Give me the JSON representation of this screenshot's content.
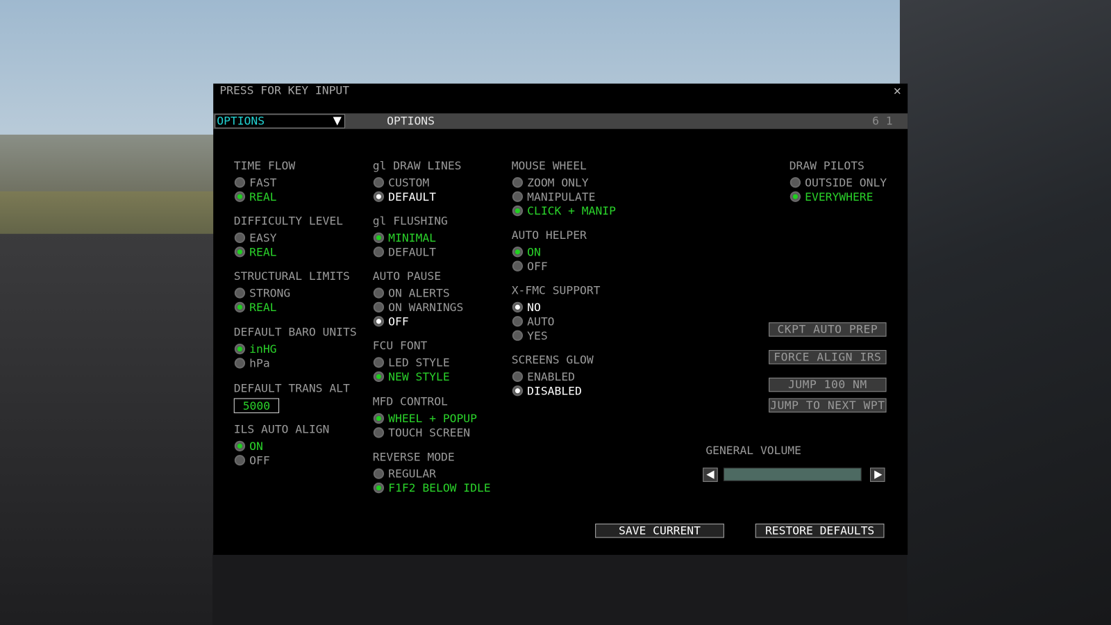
{
  "window": {
    "title": "PRESS FOR KEY INPUT",
    "close_icon": "close-icon"
  },
  "header_bar": {
    "dropdown_value": "OPTIONS",
    "title": "OPTIONS",
    "page_indicator": "6 1"
  },
  "groups": [
    {
      "title": "TIME FLOW",
      "options": [
        {
          "label": "FAST",
          "state": "off"
        },
        {
          "label": "REAL",
          "state": "green"
        }
      ]
    },
    {
      "title": "DIFFICULTY LEVEL",
      "options": [
        {
          "label": "EASY",
          "state": "off"
        },
        {
          "label": "REAL",
          "state": "green"
        }
      ]
    },
    {
      "title": "STRUCTURAL LIMITS",
      "options": [
        {
          "label": "STRONG",
          "state": "off"
        },
        {
          "label": "REAL",
          "state": "green"
        }
      ]
    },
    {
      "title": "DEFAULT BARO UNITS",
      "options": [
        {
          "label": "inHG",
          "state": "green"
        },
        {
          "label": "hPa",
          "state": "off"
        }
      ]
    },
    {
      "title": "ILS AUTO ALIGN",
      "options": [
        {
          "label": "ON",
          "state": "green"
        },
        {
          "label": "OFF",
          "state": "off"
        }
      ]
    },
    {
      "title": "gl DRAW LINES",
      "options": [
        {
          "label": "CUSTOM",
          "state": "off"
        },
        {
          "label": "DEFAULT",
          "state": "white"
        }
      ]
    },
    {
      "title": "gl FLUSHING",
      "options": [
        {
          "label": "MINIMAL",
          "state": "green"
        },
        {
          "label": "DEFAULT",
          "state": "off"
        }
      ]
    },
    {
      "title": "AUTO PAUSE",
      "options": [
        {
          "label": "ON ALERTS",
          "state": "off"
        },
        {
          "label": "ON WARNINGS",
          "state": "off"
        },
        {
          "label": "OFF",
          "state": "white"
        }
      ]
    },
    {
      "title": "FCU FONT",
      "options": [
        {
          "label": "LED STYLE",
          "state": "off"
        },
        {
          "label": "NEW STYLE",
          "state": "green"
        }
      ]
    },
    {
      "title": "MFD CONTROL",
      "options": [
        {
          "label": "WHEEL + POPUP",
          "state": "green"
        },
        {
          "label": "TOUCH SCREEN",
          "state": "off"
        }
      ]
    },
    {
      "title": "REVERSE MODE",
      "options": [
        {
          "label": "REGULAR",
          "state": "off"
        },
        {
          "label": "F1F2 BELOW IDLE",
          "state": "green"
        }
      ]
    },
    {
      "title": "MOUSE WHEEL",
      "options": [
        {
          "label": "ZOOM ONLY",
          "state": "off"
        },
        {
          "label": "MANIPULATE",
          "state": "off"
        },
        {
          "label": "CLICK + MANIP",
          "state": "green"
        }
      ]
    },
    {
      "title": "AUTO HELPER",
      "options": [
        {
          "label": "ON",
          "state": "green"
        },
        {
          "label": "OFF",
          "state": "off"
        }
      ]
    },
    {
      "title": "X-FMC SUPPORT",
      "options": [
        {
          "label": "NO",
          "state": "white"
        },
        {
          "label": "AUTO",
          "state": "off"
        },
        {
          "label": "YES",
          "state": "off"
        }
      ]
    },
    {
      "title": "SCREENS GLOW",
      "options": [
        {
          "label": "ENABLED",
          "state": "off"
        },
        {
          "label": "DISABLED",
          "state": "white"
        }
      ]
    },
    {
      "title": "DRAW PILOTS",
      "options": [
        {
          "label": "OUTSIDE ONLY",
          "state": "off"
        },
        {
          "label": "EVERYWHERE",
          "state": "green"
        }
      ]
    }
  ],
  "trans_alt": {
    "title": "DEFAULT TRANS ALT",
    "value": "5000"
  },
  "actions": {
    "ckpt_auto_prep": "CKPT AUTO PREP",
    "force_align_irs": "FORCE ALIGN IRS",
    "jump_100nm": "JUMP 100 NM",
    "jump_next_wpt": "JUMP TO NEXT WPT"
  },
  "volume": {
    "label": "GENERAL VOLUME",
    "level_percent": 100
  },
  "footer": {
    "save": "SAVE CURRENT",
    "restore": "RESTORE DEFAULTS"
  },
  "colors": {
    "selected_green": "#2ad22a",
    "dropdown_cyan": "#22d3d3",
    "volume_fill": "#4d6a62"
  }
}
